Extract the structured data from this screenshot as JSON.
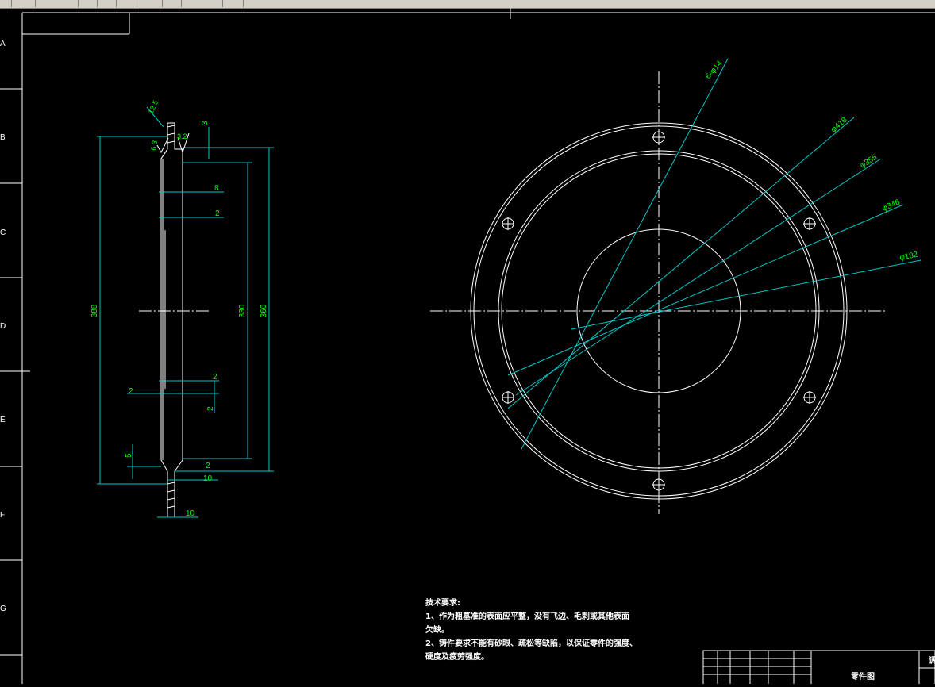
{
  "colors": {
    "background": "#000000",
    "geometry": "#ffffff",
    "dimension": "#00c8c8",
    "dimension_text": "#00ff00",
    "frame": "#ffffff",
    "toolbar": "#d4d0c8"
  },
  "toolbar": {
    "icons": [
      "arrow-icon",
      "pointer-icon",
      "zoom-icon",
      "pan-icon",
      "properties-icon",
      "copy-icon",
      "print-icon",
      "layer-icon",
      "settings-icon",
      "help-icon"
    ]
  },
  "border_zones": [
    "A",
    "B",
    "C",
    "D",
    "E",
    "F",
    "G"
  ],
  "section_view": {
    "overall_height": "388",
    "inner_height": "330",
    "outer_height": "360",
    "thickness_top": "8",
    "step_top": "2",
    "step_mid_1": "2",
    "step_mid_2": "2",
    "step_mid_3": "2",
    "bottom_height": "5",
    "bottom_step": "2",
    "bottom_width": "10",
    "foot_width": "10",
    "top_offset": "3",
    "roughness_1": "6.3",
    "roughness_2": "3.2",
    "roughness_3": "12.5"
  },
  "front_view": {
    "hole_callout": "6-φ14",
    "dia_outer": "φ418",
    "dia_bolt": "φ355",
    "dia_inner": "φ346",
    "dia_bore": "φ182"
  },
  "notes": {
    "title": "技术要求:",
    "line1": "1、作为粗基准的表面应平整，没有飞边、毛刺或其他表面",
    "line1b": "欠缺。",
    "line2": "2、铸件要求不能有砂眼、疏松等缺陷，以保证零件的强度、",
    "line2b": "硬度及疲劳强度。"
  },
  "title_block": {
    "name": "零件图",
    "edge_char": "调"
  }
}
